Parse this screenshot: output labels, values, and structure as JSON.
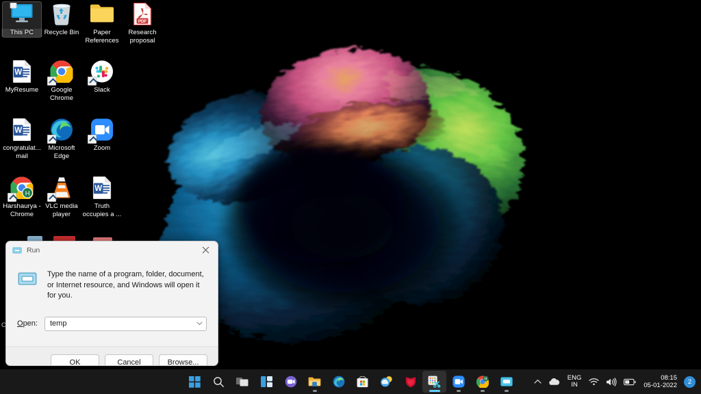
{
  "desktop": {
    "wallpaper_name": "windows-11-bloom-wallpaper",
    "background_color": "#000000",
    "icons": [
      {
        "label": "This PC",
        "icon": "this-pc-icon",
        "selected": true,
        "shortcut": false,
        "col": 0,
        "row": 0
      },
      {
        "label": "Recycle Bin",
        "icon": "recycle-bin-icon",
        "selected": false,
        "shortcut": false,
        "col": 1,
        "row": 0
      },
      {
        "label": "Paper References",
        "icon": "folder-icon",
        "selected": false,
        "shortcut": false,
        "col": 2,
        "row": 0
      },
      {
        "label": "Research proposal",
        "icon": "pdf-file-icon",
        "selected": false,
        "shortcut": false,
        "col": 3,
        "row": 0
      },
      {
        "label": "MyResume",
        "icon": "word-document-icon",
        "selected": false,
        "shortcut": false,
        "col": 0,
        "row": 1
      },
      {
        "label": "Google Chrome",
        "icon": "chrome-icon",
        "selected": false,
        "shortcut": true,
        "col": 1,
        "row": 1
      },
      {
        "label": "Slack",
        "icon": "slack-icon",
        "selected": false,
        "shortcut": true,
        "col": 2,
        "row": 1
      },
      {
        "label": "congratulat... mail",
        "icon": "word-document-icon",
        "selected": false,
        "shortcut": false,
        "col": 0,
        "row": 2
      },
      {
        "label": "Microsoft Edge",
        "icon": "edge-icon",
        "selected": false,
        "shortcut": true,
        "col": 1,
        "row": 2
      },
      {
        "label": "Zoom",
        "icon": "zoom-icon",
        "selected": false,
        "shortcut": true,
        "col": 2,
        "row": 2
      },
      {
        "label": "Harshaurya - Chrome",
        "icon": "chrome-profile-icon",
        "selected": false,
        "shortcut": true,
        "col": 0,
        "row": 3
      },
      {
        "label": "VLC media player",
        "icon": "vlc-icon",
        "selected": false,
        "shortcut": true,
        "col": 1,
        "row": 3
      },
      {
        "label": "Truth occupies a ...",
        "icon": "word-document-icon",
        "selected": false,
        "shortcut": false,
        "col": 2,
        "row": 3
      }
    ],
    "partial_row_label": "Co..."
  },
  "run_dialog": {
    "title": "Run",
    "title_icon": "run-window-icon",
    "close_icon": "close-icon",
    "description": "Type the name of a program, folder, document, or Internet resource, and Windows will open it for you.",
    "open_label": "Open:",
    "open_label_accel": "O",
    "open_value": "temp",
    "combo_caret_icon": "chevron-down-icon",
    "buttons": {
      "ok": "OK",
      "cancel": "Cancel",
      "browse": "Browse...",
      "browse_accel": "B"
    }
  },
  "taskbar": {
    "background_color": "#1a1a1a",
    "accent_color": "#60cdff",
    "items": [
      {
        "name": "start-button",
        "icon": "windows-start-icon",
        "running": false,
        "active": false
      },
      {
        "name": "search-button",
        "icon": "search-icon",
        "running": false,
        "active": false
      },
      {
        "name": "task-view-button",
        "icon": "task-view-icon",
        "running": false,
        "active": false
      },
      {
        "name": "widgets-button",
        "icon": "widgets-icon",
        "running": false,
        "active": false
      },
      {
        "name": "teams-chat-button",
        "icon": "teams-chat-icon",
        "running": false,
        "active": false
      },
      {
        "name": "file-explorer-button",
        "icon": "file-explorer-icon",
        "running": true,
        "active": false
      },
      {
        "name": "microsoft-edge-button",
        "icon": "edge-icon",
        "running": false,
        "active": false
      },
      {
        "name": "microsoft-store-button",
        "icon": "microsoft-store-icon",
        "running": false,
        "active": false
      },
      {
        "name": "weather-button",
        "icon": "weather-icon",
        "running": false,
        "active": false
      },
      {
        "name": "mcafee-button",
        "icon": "mcafee-shield-icon",
        "running": false,
        "active": false
      },
      {
        "name": "snipping-tool-button",
        "icon": "snipping-tool-icon",
        "running": true,
        "active": true
      },
      {
        "name": "zoom-button",
        "icon": "zoom-icon",
        "running": true,
        "active": false
      },
      {
        "name": "chrome-button",
        "icon": "chrome-profile-icon",
        "running": true,
        "active": false
      },
      {
        "name": "run-window-button",
        "icon": "run-window-icon",
        "running": true,
        "active": false
      }
    ],
    "tray": {
      "chevron_icon": "chevron-up-icon",
      "onedrive_icon": "onedrive-cloud-icon",
      "language_line1": "ENG",
      "language_line2": "IN",
      "wifi_icon": "wifi-icon",
      "volume_icon": "speaker-icon",
      "battery_icon": "battery-icon",
      "time": "08:15",
      "date": "05-01-2022",
      "notification_count": "2"
    }
  }
}
